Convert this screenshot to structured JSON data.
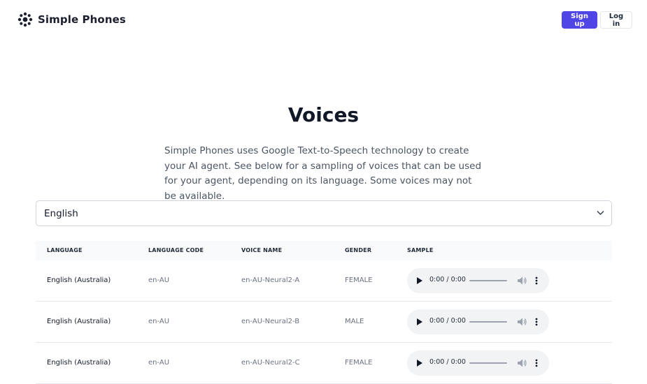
{
  "header": {
    "brand": "Simple Phones",
    "signup_label": "Sign up",
    "login_label": "Log in"
  },
  "main": {
    "title": "Voices",
    "intro": "Simple Phones uses Google Text-to-Speech technology to create your AI agent. See below for a sampling of voices that can be used for your agent, depending on its language. Some voices may not be available.",
    "language_select": {
      "value": "English"
    }
  },
  "table": {
    "headers": {
      "language": "LANGUAGE",
      "language_code": "LANGUAGE CODE",
      "voice_name": "VOICE NAME",
      "gender": "GENDER",
      "sample": "SAMPLE"
    },
    "rows": [
      {
        "language": "English (Australia)",
        "code": "en-AU",
        "voice": "en-AU-Neural2-A",
        "gender": "FEMALE",
        "time": "0:00 / 0:00"
      },
      {
        "language": "English (Australia)",
        "code": "en-AU",
        "voice": "en-AU-Neural2-B",
        "gender": "MALE",
        "time": "0:00 / 0:00"
      },
      {
        "language": "English (Australia)",
        "code": "en-AU",
        "voice": "en-AU-Neural2-C",
        "gender": "FEMALE",
        "time": "0:00 / 0:00"
      }
    ]
  },
  "colors": {
    "accent": "#4f46e5",
    "brand_icon": "#1c1f2e",
    "audio_bg": "#f1f3f4"
  },
  "icons": {
    "logo": "sparkle-dots-icon",
    "select": "chevron-down-icon",
    "play": "play-icon",
    "volume": "volume-icon",
    "more": "more-vertical-icon"
  }
}
